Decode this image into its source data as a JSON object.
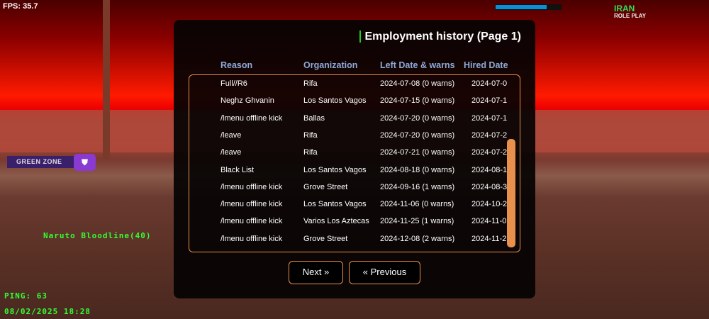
{
  "hud": {
    "fps": "FPS: 35.7",
    "ping": "PING: 63",
    "datetime": "08/02/2025 18:28",
    "nickname": "Naruto Bloodline(40)",
    "zone": "GREEN ZONE",
    "health_fraction": 0.78,
    "logo": "IRAN ROLE PLAY",
    "logo_line1": "IRAN",
    "logo_line2": "ROLE PLAY"
  },
  "panel": {
    "title": "Employment history (Page 1)",
    "columns": [
      "Reason",
      "Organization",
      "Left Date & warns",
      "Hired Date"
    ],
    "rows": [
      [
        "Full//R6",
        "Rifa",
        "2024-07-08 (0 warns)",
        "2024-07-0"
      ],
      [
        "Neghz Ghvanin",
        "Los Santos Vagos",
        "2024-07-15 (0 warns)",
        "2024-07-1"
      ],
      [
        "/lmenu offline kick",
        "Ballas",
        "2024-07-20 (0 warns)",
        "2024-07-1"
      ],
      [
        "/leave",
        "Rifa",
        "2024-07-20 (0 warns)",
        "2024-07-2"
      ],
      [
        "/leave",
        "Rifa",
        "2024-07-21 (0 warns)",
        "2024-07-2"
      ],
      [
        "Black List",
        "Los Santos Vagos",
        "2024-08-18 (0 warns)",
        "2024-08-1"
      ],
      [
        "/lmenu offline kick",
        "Grove Street",
        "2024-09-16 (1 warns)",
        "2024-08-3"
      ],
      [
        "/lmenu offline kick",
        "Los Santos Vagos",
        "2024-11-06 (0 warns)",
        "2024-10-2"
      ],
      [
        "/lmenu offline kick",
        "Varios Los Aztecas",
        "2024-11-25 (1 warns)",
        "2024-11-0"
      ],
      [
        "/lmenu offline kick",
        "Grove Street",
        "2024-12-08 (2 warns)",
        "2024-11-2"
      ]
    ],
    "next_label": "Next »",
    "prev_label": "« Previous"
  },
  "colors": {
    "accent": "#e8904c",
    "header": "#8fa9d8",
    "title_marker": "#22cc22",
    "hud_green": "#33ff33"
  }
}
